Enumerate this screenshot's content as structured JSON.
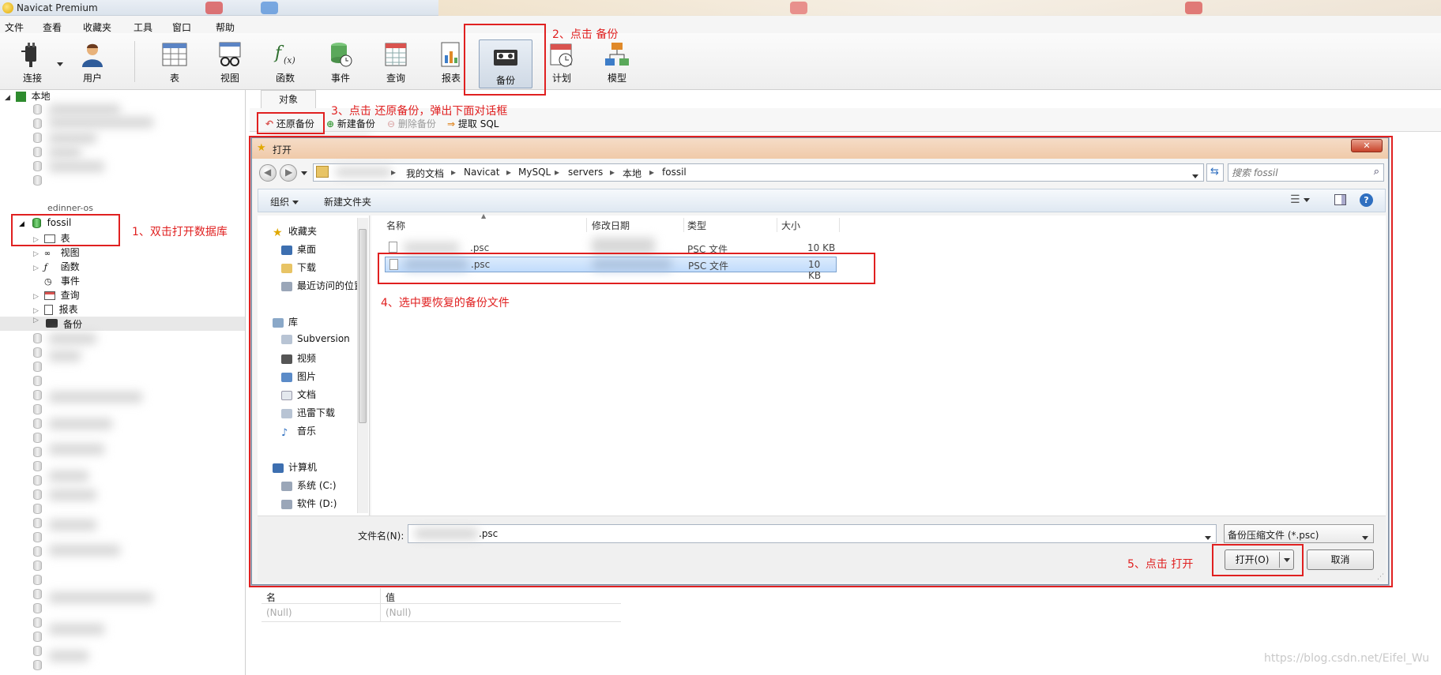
{
  "window": {
    "title": "Navicat Premium"
  },
  "menu": [
    "文件",
    "查看",
    "收藏夹",
    "工具",
    "窗口",
    "帮助"
  ],
  "toolbar": {
    "items": [
      {
        "label": "连接",
        "icon": "plug-icon"
      },
      {
        "label": "用户",
        "icon": "user-icon"
      },
      {
        "label": "表",
        "icon": "table-icon"
      },
      {
        "label": "视图",
        "icon": "view-glasses-icon"
      },
      {
        "label": "函数",
        "icon": "function-icon"
      },
      {
        "label": "事件",
        "icon": "event-icon"
      },
      {
        "label": "查询",
        "icon": "query-icon"
      },
      {
        "label": "报表",
        "icon": "report-icon"
      },
      {
        "label": "备份",
        "icon": "backup-tape-icon"
      },
      {
        "label": "计划",
        "icon": "calendar-icon"
      },
      {
        "label": "模型",
        "icon": "model-icon"
      }
    ]
  },
  "tree": {
    "root": "本地",
    "partial": "edinner-os",
    "database": "fossil",
    "children": [
      "表",
      "视图",
      "函数",
      "事件",
      "查询",
      "报表",
      "备份"
    ]
  },
  "objects_tab": "对象",
  "subtoolbar": {
    "restore": "还原备份",
    "new": "新建备份",
    "delete": "删除备份",
    "extract": "提取 SQL"
  },
  "annotations": {
    "a1": "1、双击打开数据库",
    "a2": "2、点击 备份",
    "a3": "3、点击 还原备份，弹出下面对话框",
    "a4": "4、选中要恢复的备份文件",
    "a5": "5、点击 打开"
  },
  "dialog": {
    "title": "打开",
    "close": "✕",
    "path": [
      "我的文档",
      "Navicat",
      "MySQL",
      "servers",
      "本地",
      "fossil"
    ],
    "search_placeholder": "搜索 fossil",
    "organize": "组织",
    "new_folder": "新建文件夹",
    "nav": {
      "favorites": "收藏夹",
      "fav_items": [
        "桌面",
        "下载",
        "最近访问的位置"
      ],
      "library": "库",
      "lib_items": [
        "Subversion",
        "视频",
        "图片",
        "文档",
        "迅雷下载",
        "音乐"
      ],
      "computer": "计算机",
      "drives": [
        "系统 (C:)",
        "软件 (D:)"
      ]
    },
    "columns": [
      "名称",
      "修改日期",
      "类型",
      "大小"
    ],
    "files": [
      {
        "name": ".psc",
        "type": "PSC 文件",
        "size": "10 KB",
        "selected": false
      },
      {
        "name": ".psc",
        "type": "PSC 文件",
        "size": "10 KB",
        "selected": true
      }
    ],
    "filename_label": "文件名(N):",
    "filename_value": ".psc",
    "filter": "备份压缩文件 (*.psc)",
    "open": "打开(O)",
    "cancel": "取消"
  },
  "props": {
    "col_name": "名",
    "col_value": "值",
    "null1": "(Null)",
    "null2": "(Null)"
  },
  "watermark": "https://blog.csdn.net/Eifel_Wu"
}
